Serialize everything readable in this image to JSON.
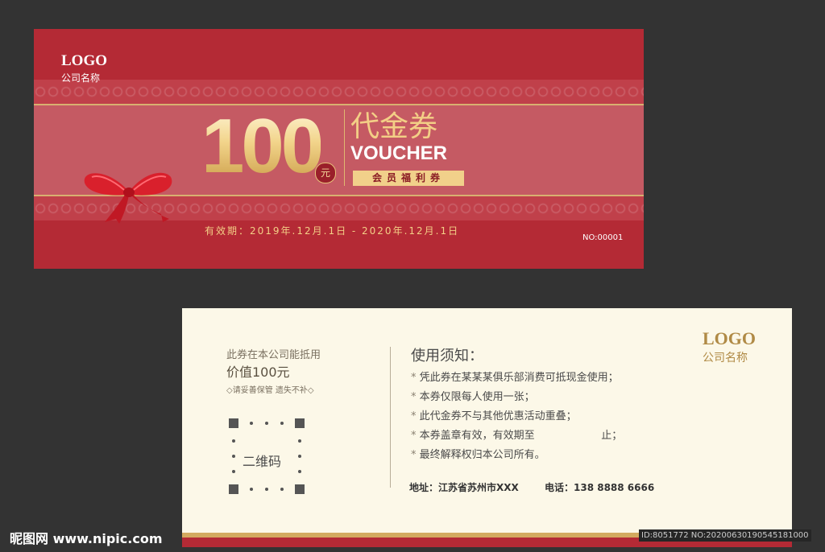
{
  "front": {
    "logo": "LOGO",
    "company": "公司名称",
    "amount": "100",
    "currency_unit": "元",
    "title_cn": "代金券",
    "title_en": "VOUCHER",
    "member_badge": "会员福利券",
    "validity": "有效期：2019年.12月.1日 - 2020年.12月.1日",
    "serial": "NO:00001"
  },
  "back": {
    "line1": "此券在本公司能抵用",
    "line2": "价值100元",
    "note": "◇请妥善保管 遗失不补◇",
    "qr_label": "二维码",
    "notice_title": "使用须知：",
    "rules": [
      "凭此券在某某某俱乐部消费可抵现金使用；",
      "本券仅限每人使用一张；",
      "此代金券不与其他优惠活动重叠；",
      "本券盖章有效，有效期至                    止；",
      "最终解释权归本公司所有。"
    ],
    "address": "地址：江苏省苏州市XXX",
    "phone": "电话：138 8888 6666",
    "logo": "LOGO",
    "company": "公司名称"
  },
  "watermark": {
    "site": "昵图网 www.nipic.com",
    "id_text": "ID:8051772 NO:20200630190545181000"
  },
  "colors": {
    "background": "#333333",
    "voucher_red": "#b42a35",
    "gold": "#f3cf86",
    "cream": "#fcf8e8"
  }
}
